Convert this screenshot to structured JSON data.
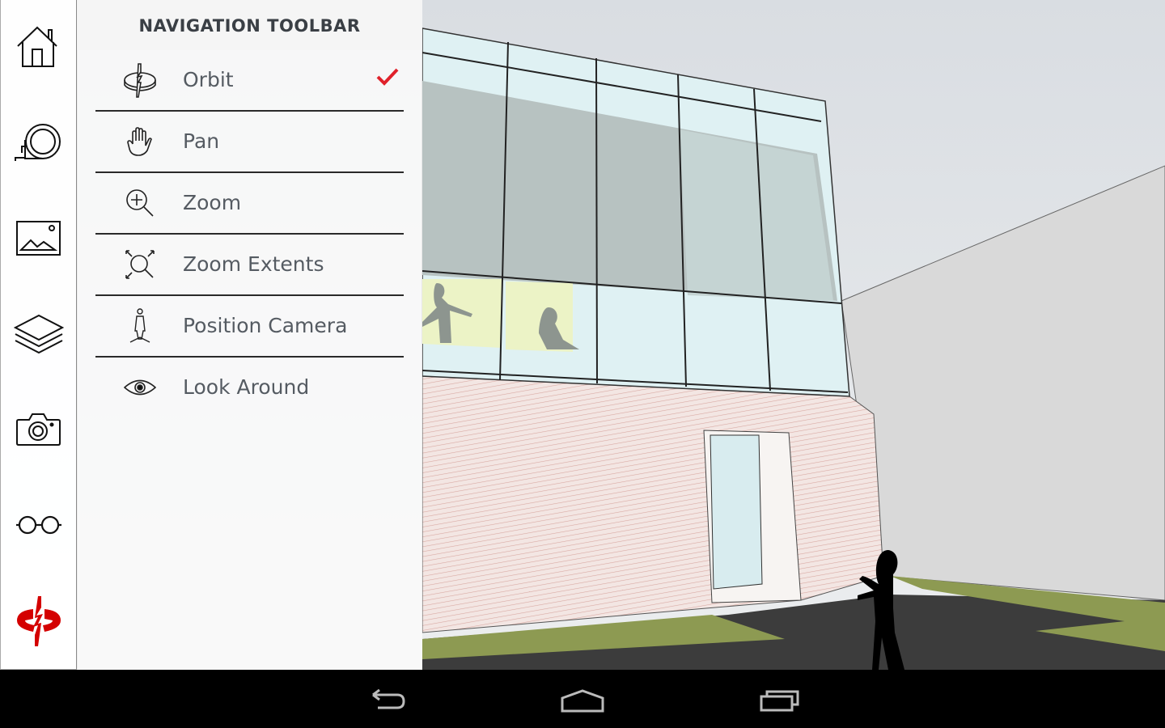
{
  "panel": {
    "title": "NAVIGATION TOOLBAR",
    "items": [
      {
        "label": "Orbit",
        "icon": "orbit-icon",
        "selected": true
      },
      {
        "label": "Pan",
        "icon": "hand-icon",
        "selected": false
      },
      {
        "label": "Zoom",
        "icon": "zoom-in-icon",
        "selected": false
      },
      {
        "label": "Zoom Extents",
        "icon": "zoom-extents-icon",
        "selected": false
      },
      {
        "label": "Position Camera",
        "icon": "position-camera-icon",
        "selected": false
      },
      {
        "label": "Look Around",
        "icon": "eye-icon",
        "selected": false
      }
    ]
  },
  "sidebar": {
    "items": [
      {
        "icon": "home-icon"
      },
      {
        "icon": "tape-measure-icon"
      },
      {
        "icon": "scenes-image-icon"
      },
      {
        "icon": "layers-icon"
      },
      {
        "icon": "camera-icon"
      },
      {
        "icon": "glasses-icon"
      },
      {
        "icon": "orbit-navigation-icon",
        "active": true
      }
    ]
  },
  "system_bar": {
    "buttons": [
      "back-icon",
      "home-icon",
      "recents-icon"
    ]
  },
  "colors": {
    "accent": "#d40000",
    "check": "#e0212b"
  }
}
